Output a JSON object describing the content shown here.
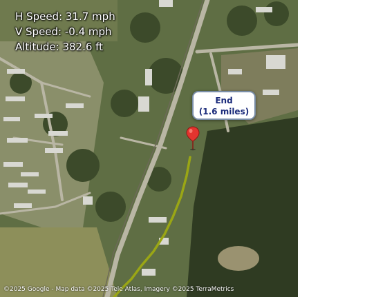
{
  "telemetry": {
    "h_speed": "H Speed: 31.7 mph",
    "v_speed": "V Speed: -0.4 mph",
    "altitude": "Altitude: 382.6 ft"
  },
  "end_marker": {
    "title": "End",
    "distance": "(1.6 miles)"
  },
  "attribution": "©2025 Google - Map data ©2025 Tele Atlas, Imagery ©2025 TerraMetrics",
  "colors": {
    "track": "#9aa615",
    "pin": "#e3342f",
    "callout_text": "#1a2a7a"
  }
}
